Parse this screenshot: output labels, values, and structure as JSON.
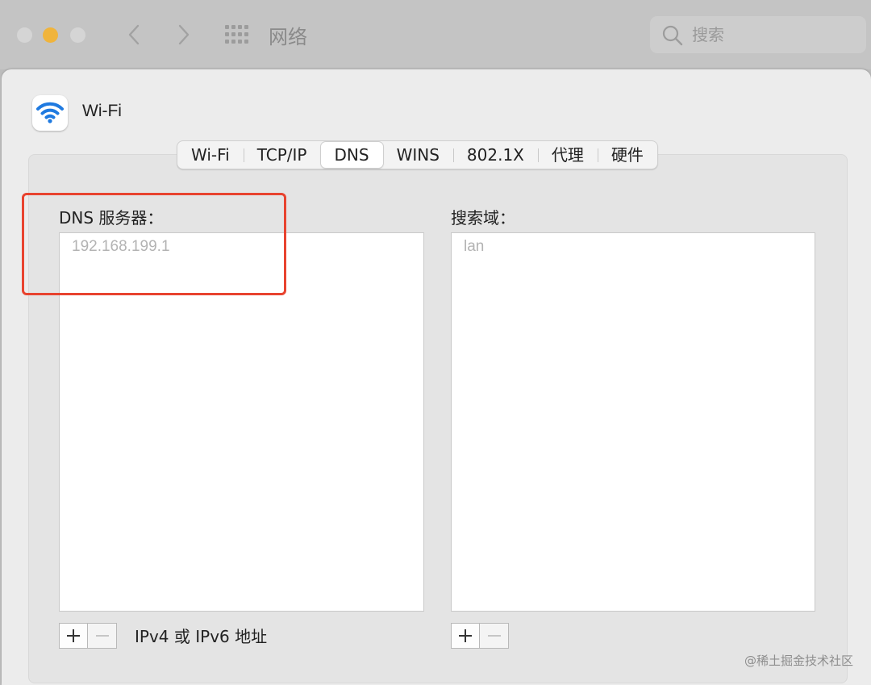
{
  "window": {
    "title": "网络"
  },
  "search": {
    "placeholder": "搜索"
  },
  "interface": {
    "name": "Wi-Fi"
  },
  "tabs": [
    {
      "label": "Wi-Fi"
    },
    {
      "label": "TCP/IP"
    },
    {
      "label": "DNS",
      "active": true
    },
    {
      "label": "WINS"
    },
    {
      "label": "802.1X"
    },
    {
      "label": "代理"
    },
    {
      "label": "硬件"
    }
  ],
  "dns": {
    "label": "DNS 服务器：",
    "entries": [
      "192.168.199.1"
    ],
    "hint": "IPv4 或 IPv6 地址"
  },
  "search_domains": {
    "label": "搜索域：",
    "entries": [
      "lan"
    ]
  },
  "buttons": {
    "add": "+",
    "remove": "−"
  },
  "watermark": "@稀土掘金技术社区",
  "colors": {
    "highlight": "#e8432f",
    "wifi_blue": "#1f7ae0",
    "minimize": "#f0b43c"
  }
}
